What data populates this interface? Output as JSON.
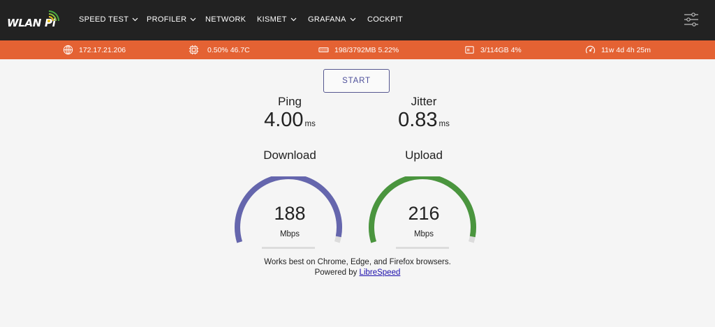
{
  "brand": {
    "logo_text": "WLAN Pi"
  },
  "nav": {
    "items": [
      {
        "label": "SPEED TEST",
        "dropdown": true
      },
      {
        "label": "PROFILER",
        "dropdown": true
      },
      {
        "label": "NETWORK",
        "dropdown": false
      },
      {
        "label": "KISMET",
        "dropdown": true
      },
      {
        "label": "GRAFANA",
        "dropdown": true
      },
      {
        "label": "COCKPIT",
        "dropdown": false
      }
    ],
    "settings_icon": "sliders-icon"
  },
  "status": {
    "ip": "172.17.21.206",
    "cpu": "0.50% 46.7C",
    "memory": "198/3792MB 5.22%",
    "disk": "3/114GB 4%",
    "uptime": "11w 4d 4h 25m"
  },
  "colors": {
    "navbar_bg": "#222222",
    "status_bg": "#e46233",
    "download_gauge": "#6566ad",
    "upload_gauge": "#4a953e",
    "start_button": "#55578f"
  },
  "speedtest": {
    "start_label": "START",
    "ping": {
      "label": "Ping",
      "value": "4.00",
      "unit": "ms"
    },
    "jitter": {
      "label": "Jitter",
      "value": "0.83",
      "unit": "ms"
    },
    "download": {
      "label": "Download",
      "value": "188",
      "unit": "Mbps",
      "gauge_fraction": 0.97
    },
    "upload": {
      "label": "Upload",
      "value": "216",
      "unit": "Mbps",
      "gauge_fraction": 0.97
    }
  },
  "footer": {
    "browsers_note": "Works best on Chrome, Edge, and Firefox browsers.",
    "powered_prefix": "Powered by ",
    "powered_link": "LibreSpeed"
  }
}
